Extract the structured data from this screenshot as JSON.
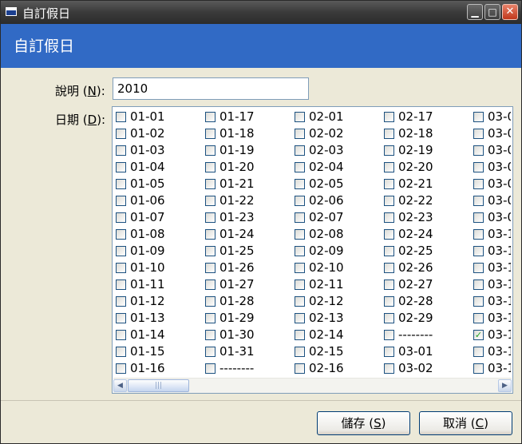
{
  "window": {
    "title": "自訂假日"
  },
  "banner": {
    "title": "自訂假日"
  },
  "labels": {
    "description_text": "說明 (",
    "description_key": "N",
    "description_end": "):",
    "date_text": "日期 (",
    "date_key": "D",
    "date_end": "):"
  },
  "description": {
    "value": "2010"
  },
  "dates": {
    "columns": [
      [
        {
          "label": "01-01",
          "checked": false
        },
        {
          "label": "01-02",
          "checked": false
        },
        {
          "label": "01-03",
          "checked": false
        },
        {
          "label": "01-04",
          "checked": false
        },
        {
          "label": "01-05",
          "checked": false
        },
        {
          "label": "01-06",
          "checked": false
        },
        {
          "label": "01-07",
          "checked": false
        },
        {
          "label": "01-08",
          "checked": false
        },
        {
          "label": "01-09",
          "checked": false
        },
        {
          "label": "01-10",
          "checked": false
        },
        {
          "label": "01-11",
          "checked": false
        },
        {
          "label": "01-12",
          "checked": false
        },
        {
          "label": "01-13",
          "checked": false
        },
        {
          "label": "01-14",
          "checked": false
        },
        {
          "label": "01-15",
          "checked": false
        },
        {
          "label": "01-16",
          "checked": false
        }
      ],
      [
        {
          "label": "01-17",
          "checked": false
        },
        {
          "label": "01-18",
          "checked": false
        },
        {
          "label": "01-19",
          "checked": false
        },
        {
          "label": "01-20",
          "checked": false
        },
        {
          "label": "01-21",
          "checked": false
        },
        {
          "label": "01-22",
          "checked": false
        },
        {
          "label": "01-23",
          "checked": false
        },
        {
          "label": "01-24",
          "checked": false
        },
        {
          "label": "01-25",
          "checked": false
        },
        {
          "label": "01-26",
          "checked": false
        },
        {
          "label": "01-27",
          "checked": false
        },
        {
          "label": "01-28",
          "checked": false
        },
        {
          "label": "01-29",
          "checked": false
        },
        {
          "label": "01-30",
          "checked": false
        },
        {
          "label": "01-31",
          "checked": false
        },
        {
          "label": "--------",
          "checked": false
        }
      ],
      [
        {
          "label": "02-01",
          "checked": false
        },
        {
          "label": "02-02",
          "checked": false
        },
        {
          "label": "02-03",
          "checked": false
        },
        {
          "label": "02-04",
          "checked": false
        },
        {
          "label": "02-05",
          "checked": false
        },
        {
          "label": "02-06",
          "checked": false
        },
        {
          "label": "02-07",
          "checked": false
        },
        {
          "label": "02-08",
          "checked": false
        },
        {
          "label": "02-09",
          "checked": false
        },
        {
          "label": "02-10",
          "checked": false
        },
        {
          "label": "02-11",
          "checked": false
        },
        {
          "label": "02-12",
          "checked": false
        },
        {
          "label": "02-13",
          "checked": false
        },
        {
          "label": "02-14",
          "checked": false
        },
        {
          "label": "02-15",
          "checked": false
        },
        {
          "label": "02-16",
          "checked": false
        }
      ],
      [
        {
          "label": "02-17",
          "checked": false
        },
        {
          "label": "02-18",
          "checked": false
        },
        {
          "label": "02-19",
          "checked": false
        },
        {
          "label": "02-20",
          "checked": false
        },
        {
          "label": "02-21",
          "checked": false
        },
        {
          "label": "02-22",
          "checked": false
        },
        {
          "label": "02-23",
          "checked": false
        },
        {
          "label": "02-24",
          "checked": false
        },
        {
          "label": "02-25",
          "checked": false
        },
        {
          "label": "02-26",
          "checked": false
        },
        {
          "label": "02-27",
          "checked": false
        },
        {
          "label": "02-28",
          "checked": false
        },
        {
          "label": "02-29",
          "checked": false
        },
        {
          "label": "--------",
          "checked": false
        },
        {
          "label": "03-01",
          "checked": false
        },
        {
          "label": "03-02",
          "checked": false
        }
      ],
      [
        {
          "label": "03-0",
          "checked": false
        },
        {
          "label": "03-0",
          "checked": false
        },
        {
          "label": "03-0",
          "checked": false
        },
        {
          "label": "03-0",
          "checked": false
        },
        {
          "label": "03-0",
          "checked": false
        },
        {
          "label": "03-0",
          "checked": false
        },
        {
          "label": "03-0",
          "checked": false
        },
        {
          "label": "03-1",
          "checked": false
        },
        {
          "label": "03-1",
          "checked": false
        },
        {
          "label": "03-1",
          "checked": false
        },
        {
          "label": "03-1",
          "checked": false
        },
        {
          "label": "03-1",
          "checked": false
        },
        {
          "label": "03-1",
          "checked": false
        },
        {
          "label": "03-1",
          "checked": true
        },
        {
          "label": "03-1",
          "checked": false
        },
        {
          "label": "03-1",
          "checked": false
        }
      ]
    ]
  },
  "buttons": {
    "save_text": "儲存 (",
    "save_key": "S",
    "save_end": ")",
    "cancel_text": "取消 (",
    "cancel_key": "C",
    "cancel_end": ")"
  },
  "icons": {
    "minimize": "minimize-icon",
    "maximize": "maximize-icon",
    "close": "close-icon",
    "scroll_left": "scroll-left-icon",
    "scroll_right": "scroll-right-icon"
  },
  "colors": {
    "banner": "#316ac5",
    "dialog_bg": "#ece9d8",
    "check_mark": "#21a121"
  }
}
